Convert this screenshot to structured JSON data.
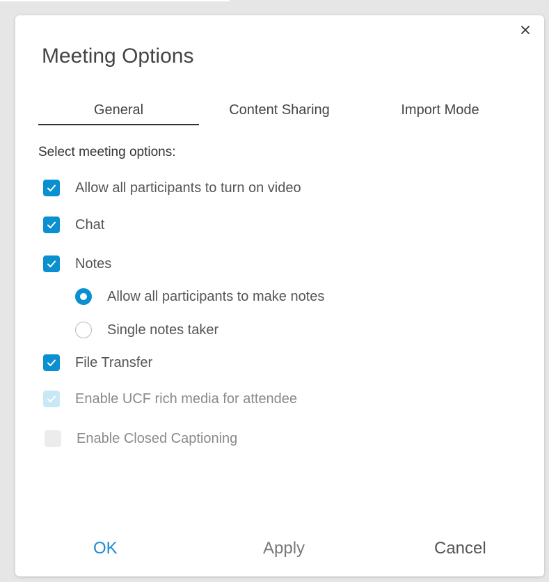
{
  "dialog": {
    "title": "Meeting Options",
    "close_icon": "close-icon"
  },
  "tabs": [
    {
      "label": "General",
      "active": true
    },
    {
      "label": "Content Sharing",
      "active": false
    },
    {
      "label": "Import Mode",
      "active": false
    }
  ],
  "general": {
    "section_label": "Select meeting options:",
    "options": {
      "video": {
        "label": "Allow all participants to turn on video",
        "checked": true,
        "enabled": true
      },
      "chat": {
        "label": "Chat",
        "checked": true,
        "enabled": true
      },
      "notes": {
        "label": "Notes",
        "checked": true,
        "enabled": true
      },
      "notes_all": {
        "label": "Allow all participants to make notes",
        "selected": true
      },
      "notes_single": {
        "label": "Single notes taker",
        "selected": false
      },
      "file_transfer": {
        "label": "File Transfer",
        "checked": true,
        "enabled": true
      },
      "ucf": {
        "label": "Enable UCF rich media for attendee",
        "checked": true,
        "enabled": false
      },
      "captioning": {
        "label": "Enable Closed Captioning",
        "checked": false,
        "enabled": false
      }
    }
  },
  "footer": {
    "ok_label": "OK",
    "apply_label": "Apply",
    "cancel_label": "Cancel"
  },
  "colors": {
    "accent": "#0a8fd1",
    "accent_disabled": "#c7e9f6",
    "background": "#e6e6e6"
  }
}
